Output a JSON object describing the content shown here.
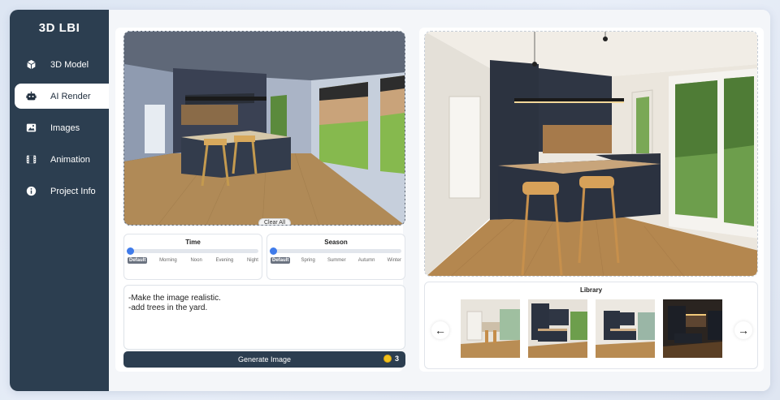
{
  "app": {
    "brand": "3D LBI"
  },
  "sidebar": {
    "items": [
      {
        "label": "3D Model",
        "icon": "cube-icon",
        "active": false
      },
      {
        "label": "AI Render",
        "icon": "robot-icon",
        "active": true
      },
      {
        "label": "Images",
        "icon": "image-icon",
        "active": false
      },
      {
        "label": "Animation",
        "icon": "film-icon",
        "active": false
      },
      {
        "label": "Project Info",
        "icon": "info-icon",
        "active": false
      }
    ]
  },
  "viewport": {
    "clear_label": "Clear All"
  },
  "time": {
    "title": "Time",
    "options": [
      "Default",
      "Morning",
      "Noon",
      "Evening",
      "Night"
    ],
    "selected": "Default"
  },
  "season": {
    "title": "Season",
    "options": [
      "Default",
      "Spring",
      "Summer",
      "Autumn",
      "Winter"
    ],
    "selected": "Default"
  },
  "prompt": {
    "text": "-Make the image realistic.\n-add trees in the yard."
  },
  "generate": {
    "label": "Generate Image",
    "credits": "3"
  },
  "library": {
    "title": "Library",
    "prev_arrow": "←",
    "next_arrow": "→",
    "thumbnails": 4
  },
  "colors": {
    "sidebar": "#2c3e50",
    "accent": "#3f7bea",
    "coin": "#f2c21d"
  }
}
